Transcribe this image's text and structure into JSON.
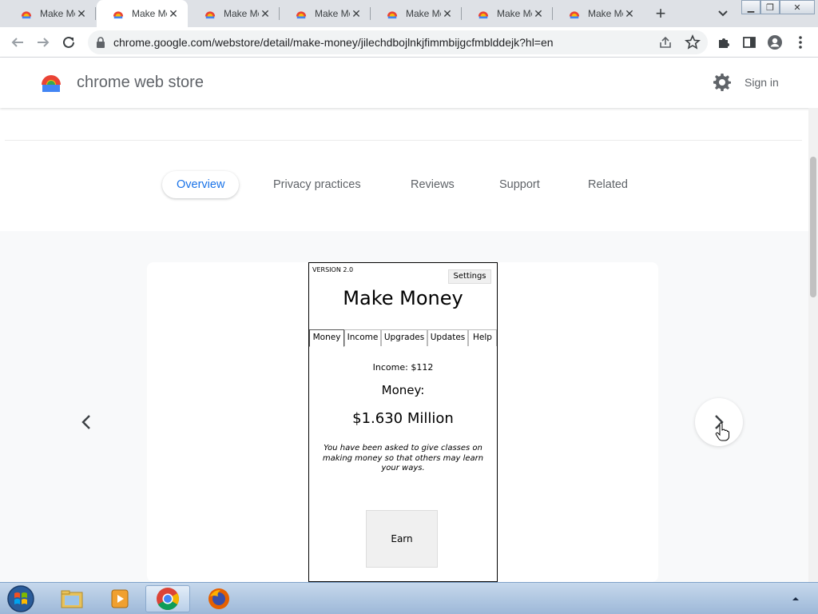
{
  "browser": {
    "tabs": [
      {
        "title": "Make Money",
        "active": false
      },
      {
        "title": "Make Money",
        "active": true
      },
      {
        "title": "Make Money",
        "active": false
      },
      {
        "title": "Make Money",
        "active": false
      },
      {
        "title": "Make Money",
        "active": false
      },
      {
        "title": "Make Money",
        "active": false
      },
      {
        "title": "Make Money",
        "active": false
      }
    ],
    "new_tab_icon": "plus-icon",
    "url": "chrome.google.com/webstore/detail/make-money/jilechdbojlnkjfimmbijgcfmblddejk?hl=en"
  },
  "store": {
    "name": "chrome web store",
    "sign_in": "Sign in"
  },
  "nav_tabs": [
    {
      "label": "Overview",
      "active": true
    },
    {
      "label": "Privacy practices",
      "active": false
    },
    {
      "label": "Reviews",
      "active": false
    },
    {
      "label": "Support",
      "active": false
    },
    {
      "label": "Related",
      "active": false
    }
  ],
  "preview": {
    "version": "VERSION 2.0",
    "settings": "Settings",
    "title": "Make Money",
    "tabs": [
      "Money",
      "Income",
      "Upgrades",
      "Updates",
      "Help"
    ],
    "active_tab": "Money",
    "income": "Income: $112",
    "money_label": "Money:",
    "money_value": "$1.630 Million",
    "message": "You have been asked to give classes on making money so that others may learn your ways.",
    "earn": "Earn"
  },
  "colors": {
    "accent": "#1a73e8",
    "tabstrip": "#dee1e6",
    "gallery_bg": "#f8f9fa"
  }
}
